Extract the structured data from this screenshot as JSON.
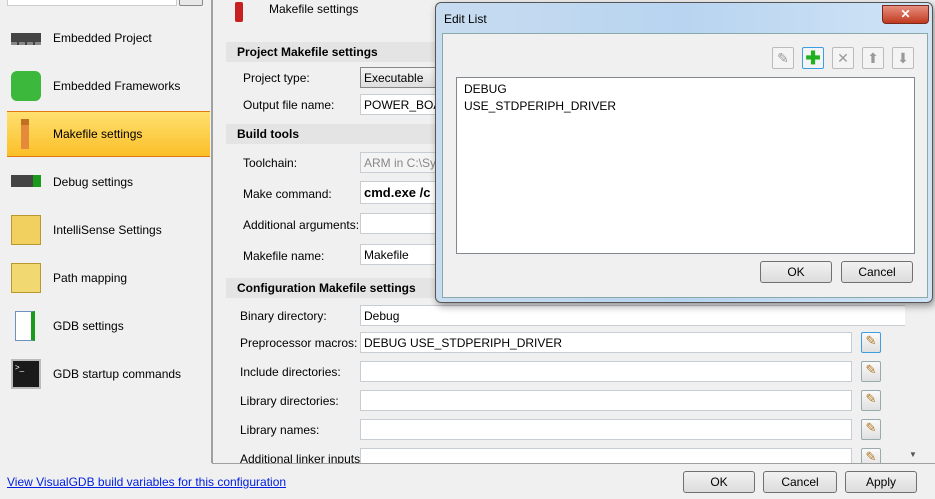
{
  "sidebar": {
    "items": [
      {
        "label": "Embedded Project",
        "icon": "chip-icon"
      },
      {
        "label": "Embedded Frameworks",
        "icon": "puzzle-icon"
      },
      {
        "label": "Makefile settings",
        "icon": "hammer-icon",
        "selected": true
      },
      {
        "label": "Debug settings",
        "icon": "chip-play-icon"
      },
      {
        "label": "IntelliSense Settings",
        "icon": "intellisense-folder-icon"
      },
      {
        "label": "Path mapping",
        "icon": "folders-icon"
      },
      {
        "label": "GDB settings",
        "icon": "document-play-icon"
      },
      {
        "label": "GDB startup commands",
        "icon": "terminal-icon"
      }
    ]
  },
  "main": {
    "title": "Makefile settings",
    "sections": {
      "project": "Project Makefile settings",
      "build": "Build tools",
      "config": "Configuration Makefile settings"
    },
    "fields": {
      "project_type": {
        "label": "Project type:",
        "value": "Executable"
      },
      "output_file": {
        "label": "Output file name:",
        "value": "POWER_BOAR"
      },
      "toolchain": {
        "label": "Toolchain:",
        "value": "ARM in C:\\Sys"
      },
      "make_command": {
        "label": "Make command:",
        "value": "cmd.exe /c \""
      },
      "additional_args": {
        "label": "Additional arguments:",
        "value": ""
      },
      "makefile_name": {
        "label": "Makefile name:",
        "value": "Makefile"
      },
      "binary_dir": {
        "label": "Binary directory:",
        "value": "Debug"
      },
      "preproc": {
        "label": "Preprocessor macros:",
        "value": "DEBUG USE_STDPERIPH_DRIVER"
      },
      "include_dirs": {
        "label": "Include directories:",
        "value": ""
      },
      "library_dirs": {
        "label": "Library directories:",
        "value": ""
      },
      "library_names": {
        "label": "Library names:",
        "value": ""
      },
      "linker_inputs": {
        "label": "Additional linker inputs:",
        "value": ""
      }
    }
  },
  "footer": {
    "link": "View VisualGDB build variables for this configuration",
    "ok": "OK",
    "cancel": "Cancel",
    "apply": "Apply"
  },
  "dialog": {
    "title": "Edit List",
    "close": "✕",
    "items": [
      "DEBUG",
      "USE_STDPERIPH_DRIVER"
    ],
    "ok": "OK",
    "cancel": "Cancel"
  }
}
